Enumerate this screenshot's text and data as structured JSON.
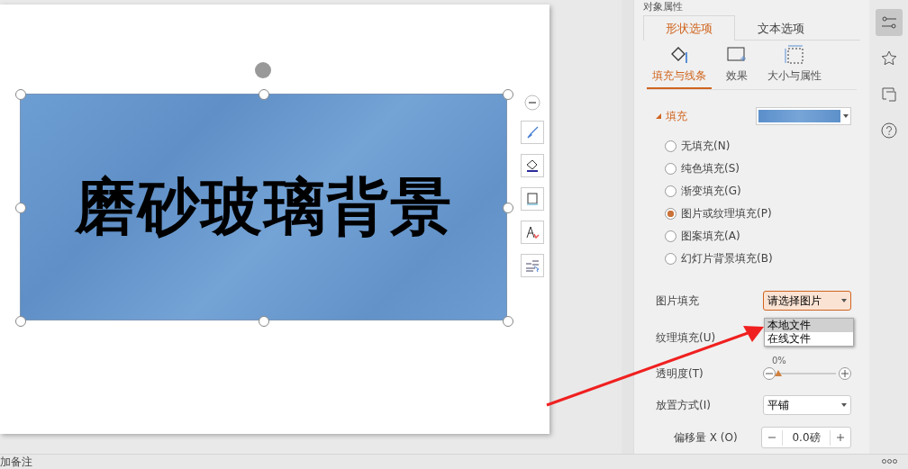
{
  "slide": {
    "shape_text": "磨砂玻璃背景"
  },
  "panel": {
    "title": "对象属性",
    "tabs": [
      {
        "label": "形状选项",
        "selected": true
      },
      {
        "label": "文本选项",
        "selected": false
      }
    ],
    "subtabs": [
      {
        "label": "填充与线条",
        "selected": true,
        "kind": "fill"
      },
      {
        "label": "效果",
        "selected": false,
        "kind": "effect"
      },
      {
        "label": "大小与属性",
        "selected": false,
        "kind": "size"
      }
    ],
    "fill_section": {
      "title": "填充",
      "expanded": true
    },
    "fill_options": [
      {
        "label": "无填充(N)",
        "selected": false
      },
      {
        "label": "纯色填充(S)",
        "selected": false
      },
      {
        "label": "渐变填充(G)",
        "selected": false
      },
      {
        "label": "图片或纹理填充(P)",
        "selected": true
      },
      {
        "label": "图案填充(A)",
        "selected": false
      },
      {
        "label": "幻灯片背景填充(B)",
        "selected": false
      }
    ],
    "picture_fill": {
      "label": "图片填充",
      "value": "请选择图片",
      "menu": [
        {
          "label": "本地文件",
          "selected": true
        },
        {
          "label": "在线文件",
          "selected": false
        }
      ]
    },
    "texture_fill": {
      "label": "纹理填充(U)"
    },
    "transparency": {
      "label": "透明度(T)",
      "reading": "0%",
      "level": 0
    },
    "placement": {
      "label": "放置方式(I)",
      "value": "平铺"
    },
    "offset_x": {
      "label": "偏移量 X (O)",
      "value": "0.0磅"
    }
  },
  "notes": {
    "text": "加备注"
  }
}
